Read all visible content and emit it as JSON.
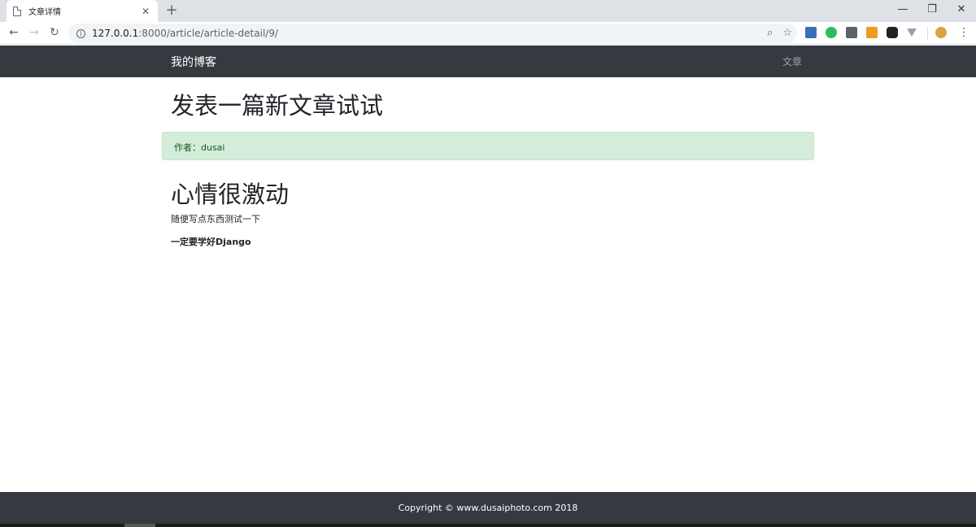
{
  "browser": {
    "tab": {
      "title": "文章详情",
      "close_glyph": "✕",
      "icon": "document-icon"
    },
    "new_tab_glyph": "+",
    "window": {
      "minimize": "—",
      "restore": "❐",
      "close": "✕"
    },
    "nav": {
      "back": "←",
      "forward": "→",
      "reload": "↻"
    },
    "url": {
      "info_glyph": "i",
      "host": "127.0.0.1",
      "rest": ":8000/article/article-detail/9/"
    },
    "omnibox_icons": {
      "zoom": "⌕",
      "bookmark": "☆"
    },
    "menu": "⋮",
    "extensions": [
      {
        "name": "bookmark-ext-icon",
        "color": "#3b6fb6"
      },
      {
        "name": "evernote-icon",
        "color": "#2dbe60"
      },
      {
        "name": "mail-icon",
        "color": "#5f6368"
      },
      {
        "name": "rss-icon",
        "color": "#f29a1e"
      },
      {
        "name": "tampermonkey-icon",
        "color": "#222222"
      },
      {
        "name": "vue-devtools-icon",
        "color": "#9aa0a6"
      },
      {
        "name": "profile-avatar-icon",
        "color": "#d9a441"
      }
    ]
  },
  "navbar": {
    "brand": "我的博客",
    "link": "文章",
    "bg": "#343a40"
  },
  "article": {
    "title": "发表一篇新文章试试",
    "author_line": "作者：dusai",
    "heading": "心情很激动",
    "paragraph": "随便写点东西测试一下",
    "strong": "一定要学好Django"
  },
  "footer": {
    "text": "Copyright © www.dusaiphoto.com 2018"
  },
  "colors": {
    "alert_bg": "#d4edda",
    "alert_text": "#155724",
    "dark": "#343a40"
  }
}
